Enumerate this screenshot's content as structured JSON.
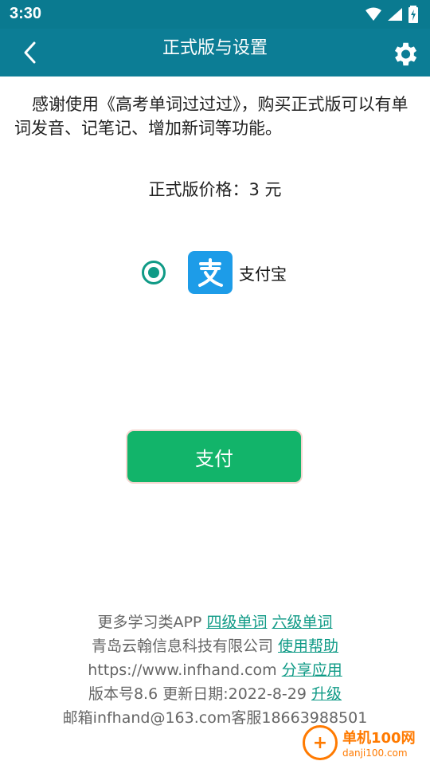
{
  "statusbar": {
    "time": "3:30",
    "icons": [
      "wifi-icon",
      "signal-icon",
      "battery-charging-icon"
    ]
  },
  "appbar": {
    "title": "正式版与设置",
    "back_icon": "chevron-left-icon",
    "settings_icon": "gear-icon"
  },
  "intro": "感谢使用《高考单词过过过》，购买正式版可以有单词发音、记笔记、增加新词等功能。",
  "price": "正式版价格：3 元",
  "payment": {
    "method_label": "支付宝",
    "selected": true,
    "logo_char": "支"
  },
  "pay_button": "支付",
  "footer": {
    "line1_text": "更多学习类APP",
    "line1_link1": "四级单词",
    "line1_link2": "六级单词",
    "line2_text": "青岛云翰信息科技有限公司",
    "line2_link": "使用帮助",
    "line3_text": "https://www.infhand.com",
    "line3_link": "分享应用",
    "line4_text": "版本号8.6 更新日期:2022-8-29",
    "line4_link": "升级",
    "line5_text": "邮箱infhand@163.com客服18663988501"
  },
  "watermark": {
    "top": "单机100网",
    "bottom": "danji100.com",
    "colors": {
      "accent": "#ff7a00"
    }
  },
  "colors": {
    "appbar": "#0c7d95",
    "accent": "#0f9a86",
    "pay_button": "#12b46a",
    "alipay": "#1d9ce8"
  }
}
